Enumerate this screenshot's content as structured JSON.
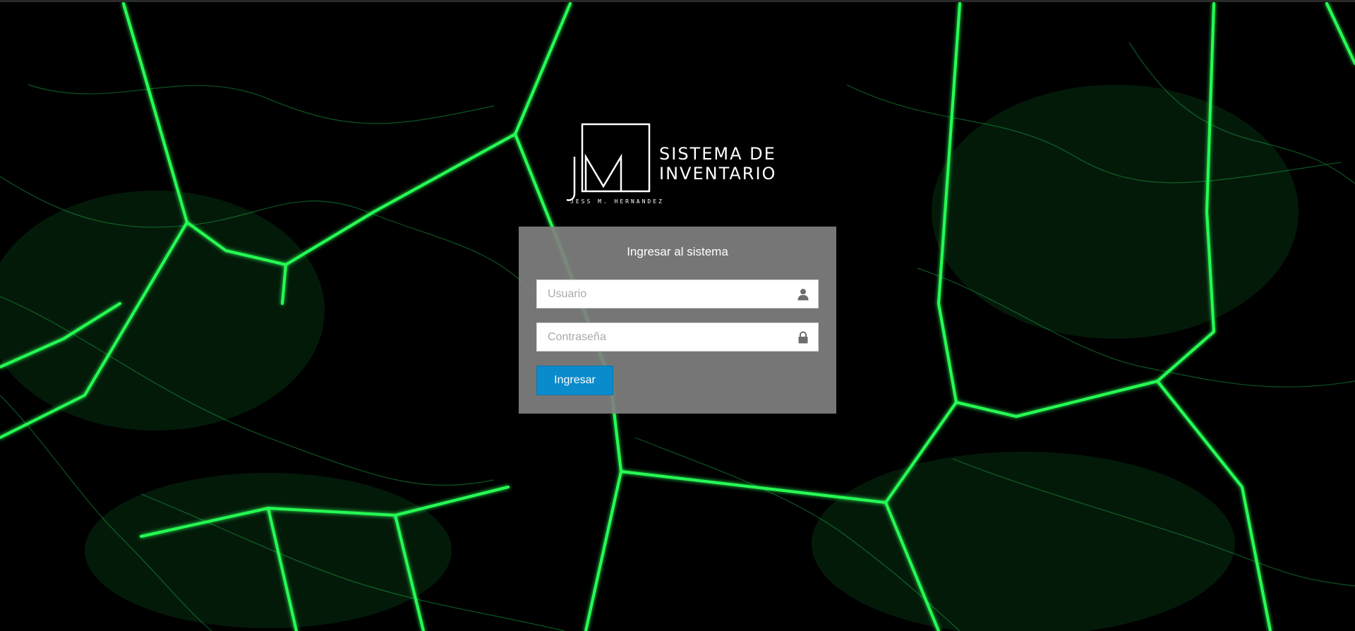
{
  "brand": {
    "logo_letters": "JM",
    "title_line1": "SISTEMA DE",
    "title_line2": "INVENTARIO",
    "subtitle": "JESS M. HERNANDEZ"
  },
  "login": {
    "title": "Ingresar al sistema",
    "username_placeholder": "Usuario",
    "username_value": "",
    "password_placeholder": "Contraseña",
    "password_value": "",
    "submit_label": "Ingresar"
  },
  "icons": {
    "username": "user-icon",
    "password": "lock-icon"
  },
  "colors": {
    "background": "#000000",
    "network_green": "#2bff5a",
    "panel": "#808080",
    "button": "#0a8bcc",
    "button_text": "#ffffff"
  }
}
